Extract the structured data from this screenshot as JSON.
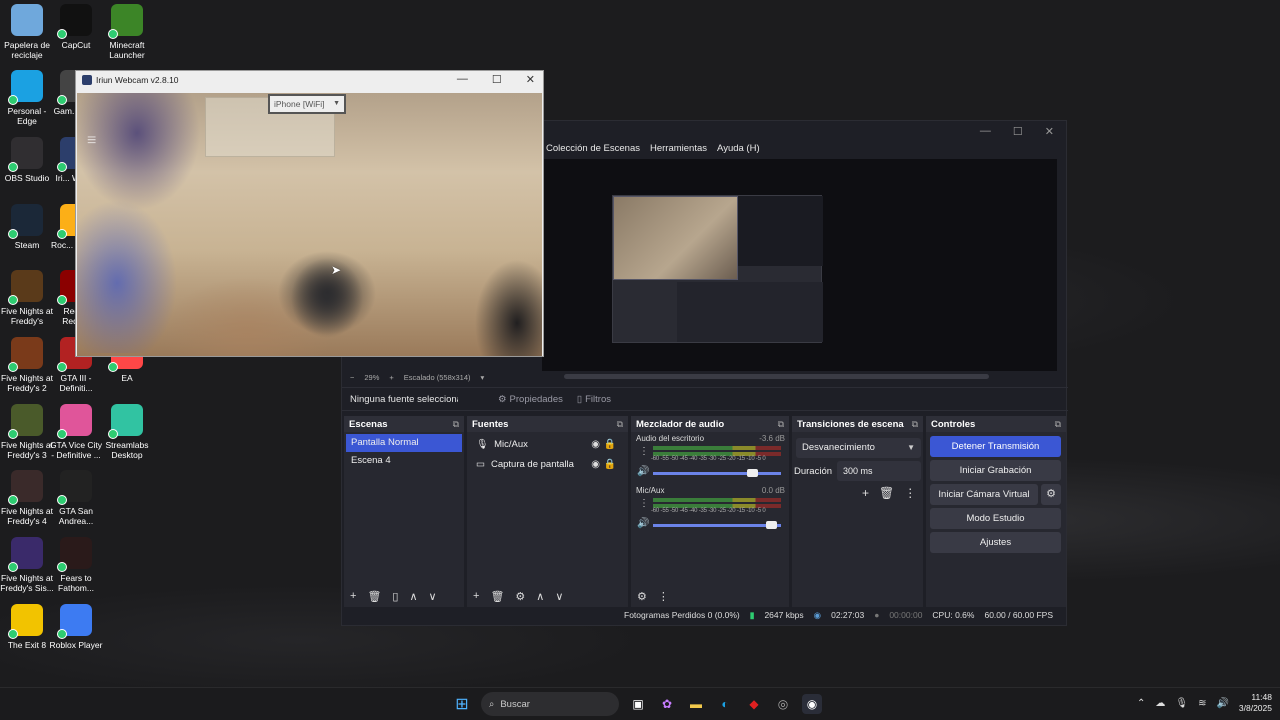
{
  "desktop": {
    "icons": [
      {
        "label": "Papelera de reciclaje",
        "icon": "recycle-bin-icon",
        "color": "#6fa8dc"
      },
      {
        "label": "CapCut",
        "icon": "capcut-icon",
        "color": "#111111"
      },
      {
        "label": "Minecraft Launcher",
        "icon": "minecraft-icon",
        "color": "#3c8527"
      },
      {
        "label": "Personal - Edge",
        "icon": "edge-icon",
        "color": "#1ba1e2"
      },
      {
        "label": "Gam... Cli...",
        "icon": "game-client-icon",
        "color": "#444444"
      },
      {
        "label": "OBS Studio",
        "icon": "obs-icon",
        "color": "#302e31"
      },
      {
        "label": "Iri... Web...",
        "icon": "iriun-icon",
        "color": "#2c3e6b"
      },
      {
        "label": "Steam",
        "icon": "steam-icon",
        "color": "#1b2838"
      },
      {
        "label": "Roc... Gam...",
        "icon": "rockstar-icon",
        "color": "#fcaf17"
      },
      {
        "label": "Five Nights at Freddy's",
        "icon": "fnaf-icon",
        "color": "#5a3a1a"
      },
      {
        "label": "Red ... Rede...",
        "icon": "red-dead-icon",
        "color": "#8b0000"
      },
      {
        "label": "Five Nights at Freddy's 2",
        "icon": "fnaf2-icon",
        "color": "#7a3a1a"
      },
      {
        "label": "GTA III - Definiti...",
        "icon": "gta3-icon",
        "color": "#b22222"
      },
      {
        "label": "EA",
        "icon": "ea-icon",
        "color": "#ff4747"
      },
      {
        "label": "Five Nights at Freddy's 3",
        "icon": "fnaf3-icon",
        "color": "#4a5a2a"
      },
      {
        "label": "GTA Vice City - Definitive ...",
        "icon": "gta-vc-icon",
        "color": "#e0559a"
      },
      {
        "label": "Streamlabs Desktop",
        "icon": "streamlabs-icon",
        "color": "#31c3a2"
      },
      {
        "label": "Five Nights at Freddy's 4",
        "icon": "fnaf4-icon",
        "color": "#3a2a2a"
      },
      {
        "label": "GTA San Andrea...",
        "icon": "gta-sa-icon",
        "color": "#222222"
      },
      {
        "label": "Five Nights at Freddy's Sis...",
        "icon": "fnaf-sl-icon",
        "color": "#3a2a6a"
      },
      {
        "label": "Fears to Fathom...",
        "icon": "fears-icon",
        "color": "#2a1a1a"
      },
      {
        "label": "The Exit 8",
        "icon": "exit8-icon",
        "color": "#f2c300"
      },
      {
        "label": "Roblox Player",
        "icon": "roblox-icon",
        "color": "#3d7bf2"
      }
    ]
  },
  "iriun": {
    "title": "Iriun Webcam v2.8.10",
    "device": "iPhone [WiFi]",
    "controls": {
      "minimize": "—",
      "maximize": "☐",
      "close": "✕"
    }
  },
  "obs": {
    "menu": [
      "Colección de Escenas",
      "Herramientas",
      "Ayuda (H)"
    ],
    "zoom": "29%",
    "zoom_plus": "+",
    "zoom_minus": "−",
    "scale": "Escalado (558x314)",
    "no_source": "Ninguna fuente seleccionada",
    "properties": "Propiedades",
    "filters": "Filtros",
    "scenes": {
      "title": "Escenas",
      "items": [
        "Pantalla Normal",
        "Escena 4"
      ]
    },
    "sources": {
      "title": "Fuentes",
      "items": [
        "Mic/Aux",
        "Captura de pantalla"
      ]
    },
    "mixer": {
      "title": "Mezclador de audio",
      "scale": "-60 -55 -50 -45 -40 -35 -30 -25 -20 -15 -10 -5 0",
      "channels": [
        {
          "name": "Audio del escritorio",
          "db": "-3.6 dB",
          "level": 0.82
        },
        {
          "name": "Mic/Aux",
          "db": "0.0 dB",
          "level": 0.97
        }
      ]
    },
    "transitions": {
      "title": "Transiciones de escena",
      "selected": "Desvanecimiento",
      "duration_label": "Duración",
      "duration": "300 ms"
    },
    "controls": {
      "title": "Controles",
      "stop_stream": "Detener Transmisión",
      "start_record": "Iniciar Grabación",
      "virtual_cam": "Iniciar Cámara Virtual",
      "studio_mode": "Modo Estudio",
      "settings": "Ajustes"
    },
    "status": {
      "dropped": "Fotogramas Perdidos 0 (0.0%)",
      "kbps": "2647 kbps",
      "stream_time": "02:27:03",
      "rec_time": "00:00:00",
      "cpu": "CPU: 0.6%",
      "fps": "60.00 / 60.00 FPS"
    },
    "accent": "#3b57d4"
  },
  "taskbar": {
    "search": "Buscar",
    "time": "11:48",
    "date": "3/8/2025"
  }
}
